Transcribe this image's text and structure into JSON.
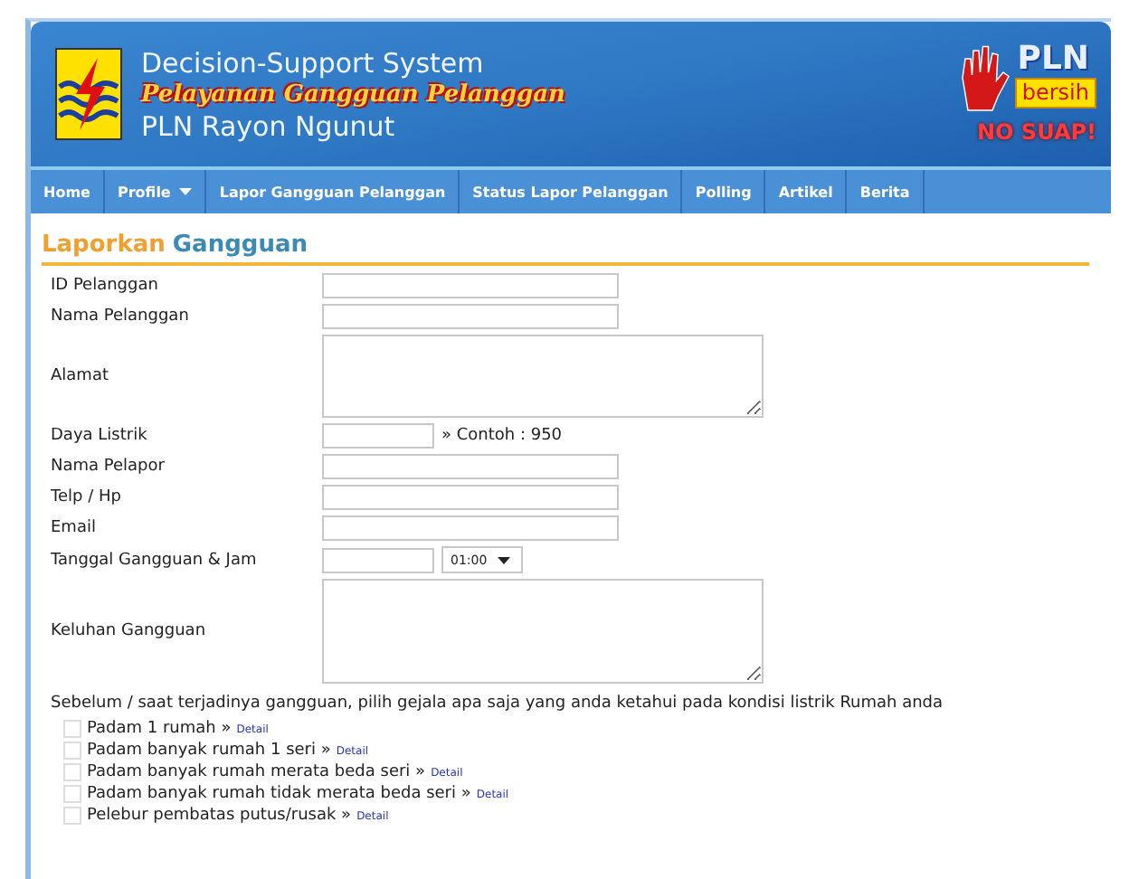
{
  "header": {
    "title": "Decision-Support System",
    "subtitle": "Pelayanan Gangguan Pelanggan",
    "unit": "PLN Rayon Ngunut",
    "badge": {
      "brand": "PLN",
      "tag": "bersih",
      "slogan": "NO SUAP!"
    }
  },
  "nav": [
    {
      "label": "Home",
      "dropdown": false
    },
    {
      "label": "Profile",
      "dropdown": true
    },
    {
      "label": "Lapor Gangguan Pelanggan",
      "dropdown": false
    },
    {
      "label": "Status Lapor Pelanggan",
      "dropdown": false
    },
    {
      "label": "Polling",
      "dropdown": false
    },
    {
      "label": "Artikel",
      "dropdown": false
    },
    {
      "label": "Berita",
      "dropdown": false
    }
  ],
  "section_title": {
    "first": "Laporkan",
    "second": "Gangguan"
  },
  "fields": [
    {
      "label": "ID Pelanggan",
      "kind": "text"
    },
    {
      "label": "Nama Pelanggan",
      "kind": "text"
    },
    {
      "label": "Alamat",
      "kind": "area"
    },
    {
      "label": "Daya Listrik",
      "kind": "short",
      "hint": "» Contoh : 950"
    },
    {
      "label": "Nama Pelapor",
      "kind": "text"
    },
    {
      "label": "Telp / Hp",
      "kind": "text"
    },
    {
      "label": "Email",
      "kind": "text"
    },
    {
      "label": "Tanggal Gangguan & Jam",
      "kind": "datetime",
      "value": "01:00"
    },
    {
      "label": "Keluhan Gangguan",
      "kind": "tallarea"
    }
  ],
  "symptoms_prompt": "Sebelum / saat terjadinya gangguan, pilih gejala apa saja yang anda ketahui pada kondisi listrik Rumah anda",
  "symptoms": [
    {
      "label": "Padam 1 rumah »",
      "link": "Detail",
      "checked": false
    },
    {
      "label": "Padam banyak rumah 1 seri »",
      "link": "Detail",
      "checked": false
    },
    {
      "label": "Padam banyak rumah merata beda seri »",
      "link": "Detail",
      "checked": false
    },
    {
      "label": "Padam banyak rumah tidak merata beda seri »",
      "link": "Detail",
      "checked": false
    },
    {
      "label": "Pelebur pembatas putus/rusak »",
      "link": "Detail",
      "checked": false
    }
  ]
}
